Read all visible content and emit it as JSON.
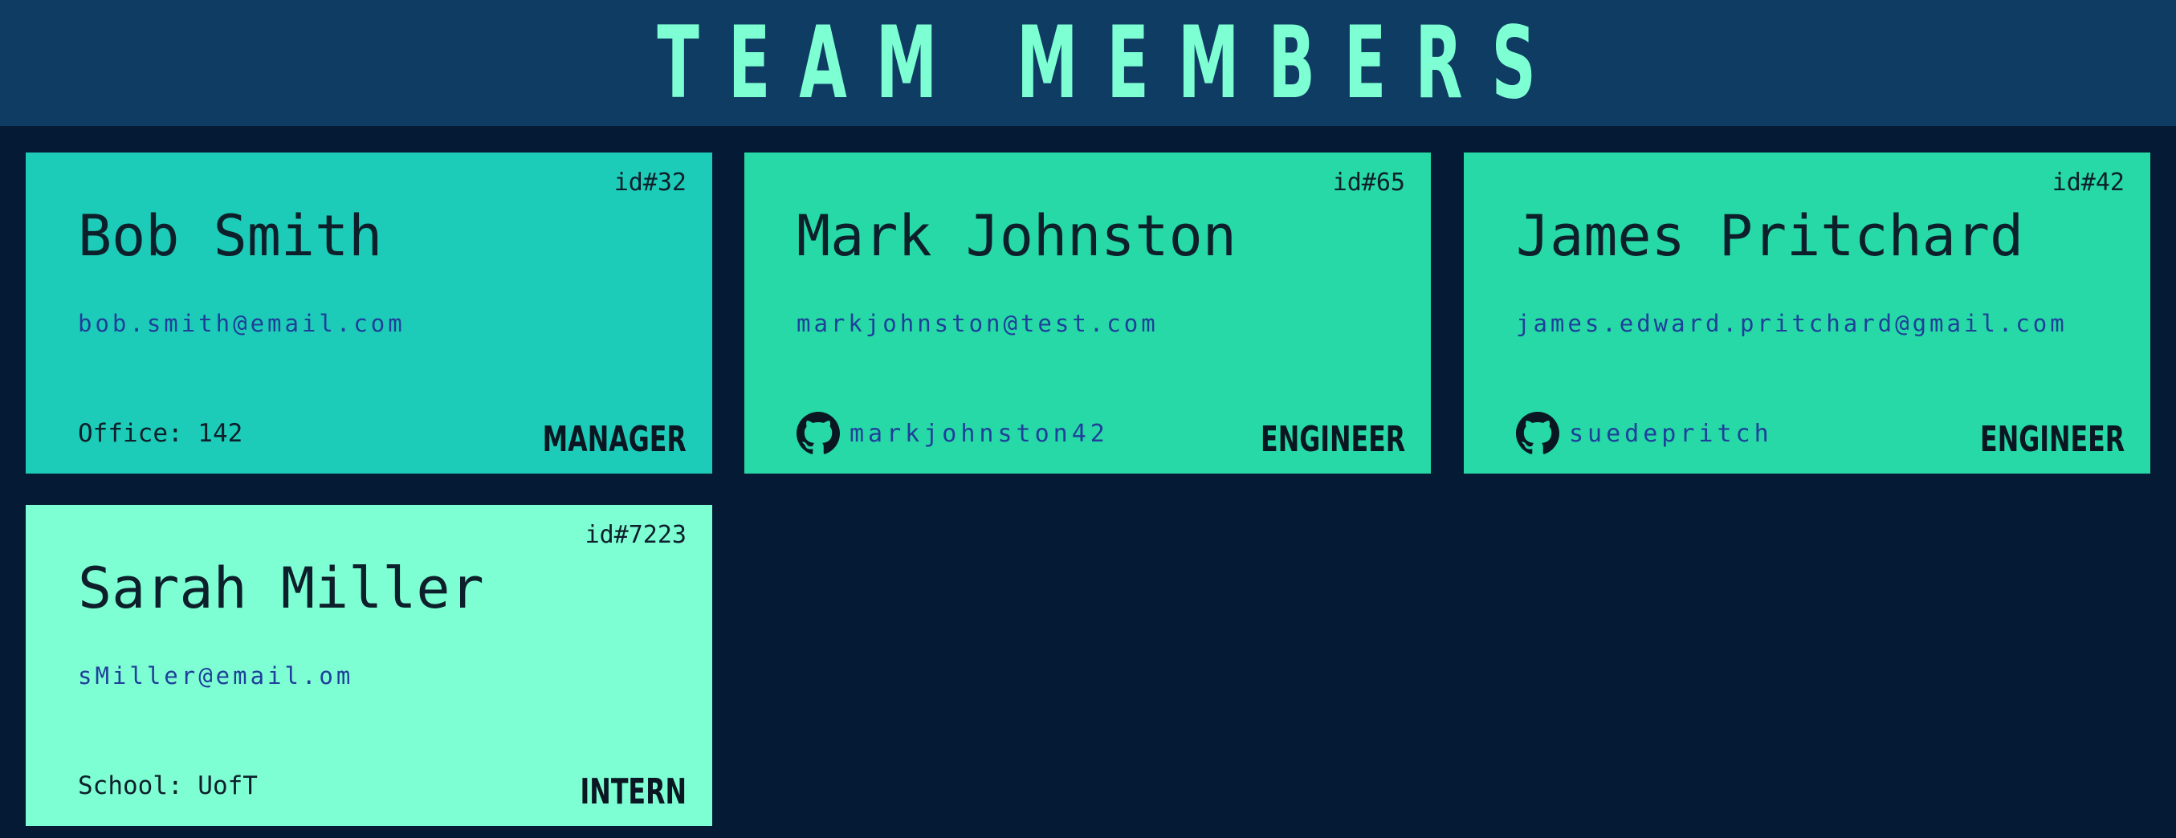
{
  "header": {
    "title": "TEAM MEMBERS"
  },
  "colors": {
    "background": "#051b35",
    "header_background": "#0e3c63",
    "title": "#7effd3",
    "manager_card": "#1dccb8",
    "engineer_card": "#26d9a6",
    "intern_card": "#7effd3",
    "email_text": "#1f3f9a"
  },
  "members": [
    {
      "id": "id#32",
      "name": "Bob Smith",
      "email": "bob.smith@email.com",
      "extra": "Office: 142",
      "role": "MANAGER"
    },
    {
      "id": "id#65",
      "name": "Mark Johnston",
      "email": "markjohnston@test.com",
      "github_icon": "github-icon",
      "github": "markjohnston42",
      "role": "ENGINEER"
    },
    {
      "id": "id#42",
      "name": "James Pritchard",
      "email": "james.edward.pritchard@gmail.com",
      "github_icon": "github-icon",
      "github": "suedepritch",
      "role": "ENGINEER"
    },
    {
      "id": "id#7223",
      "name": "Sarah Miller",
      "email": "sMiller@email.om",
      "extra": "School: UofT",
      "role": "INTERN"
    }
  ]
}
